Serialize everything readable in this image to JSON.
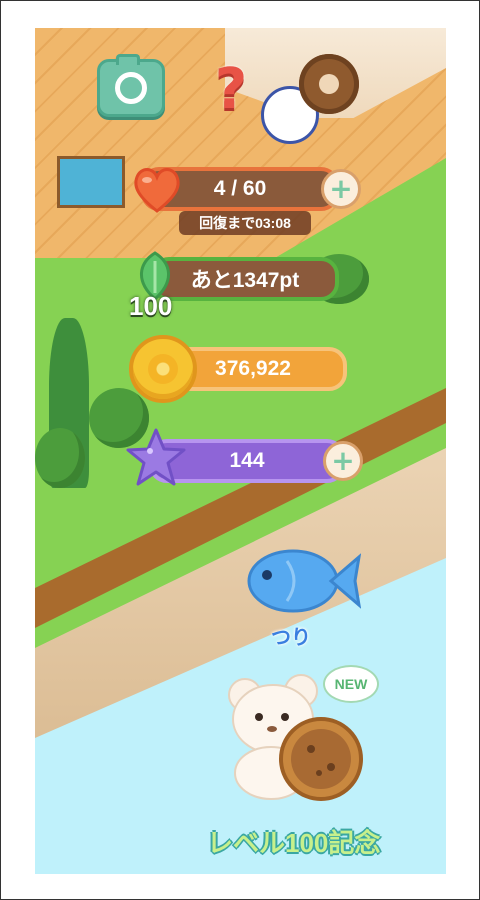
{
  "hud": {
    "stamina": {
      "value": "4 / 60",
      "recovery": "回復まで03:08"
    },
    "points": {
      "value": "あと1347pt",
      "level": "100"
    },
    "coins": {
      "value": "376,922"
    },
    "stars": {
      "value": "144"
    },
    "plus": "+"
  },
  "toolbar": {
    "help_symbol": "?"
  },
  "fishing": {
    "label": "つり"
  },
  "new_badge": "NEW",
  "caption": "レベル100記念",
  "colors": {
    "heart": "#f06a3b",
    "leaf": "#5bc46a",
    "coin": "#f6c431",
    "star": "#9b7ae3",
    "fish": "#56a9f0"
  }
}
